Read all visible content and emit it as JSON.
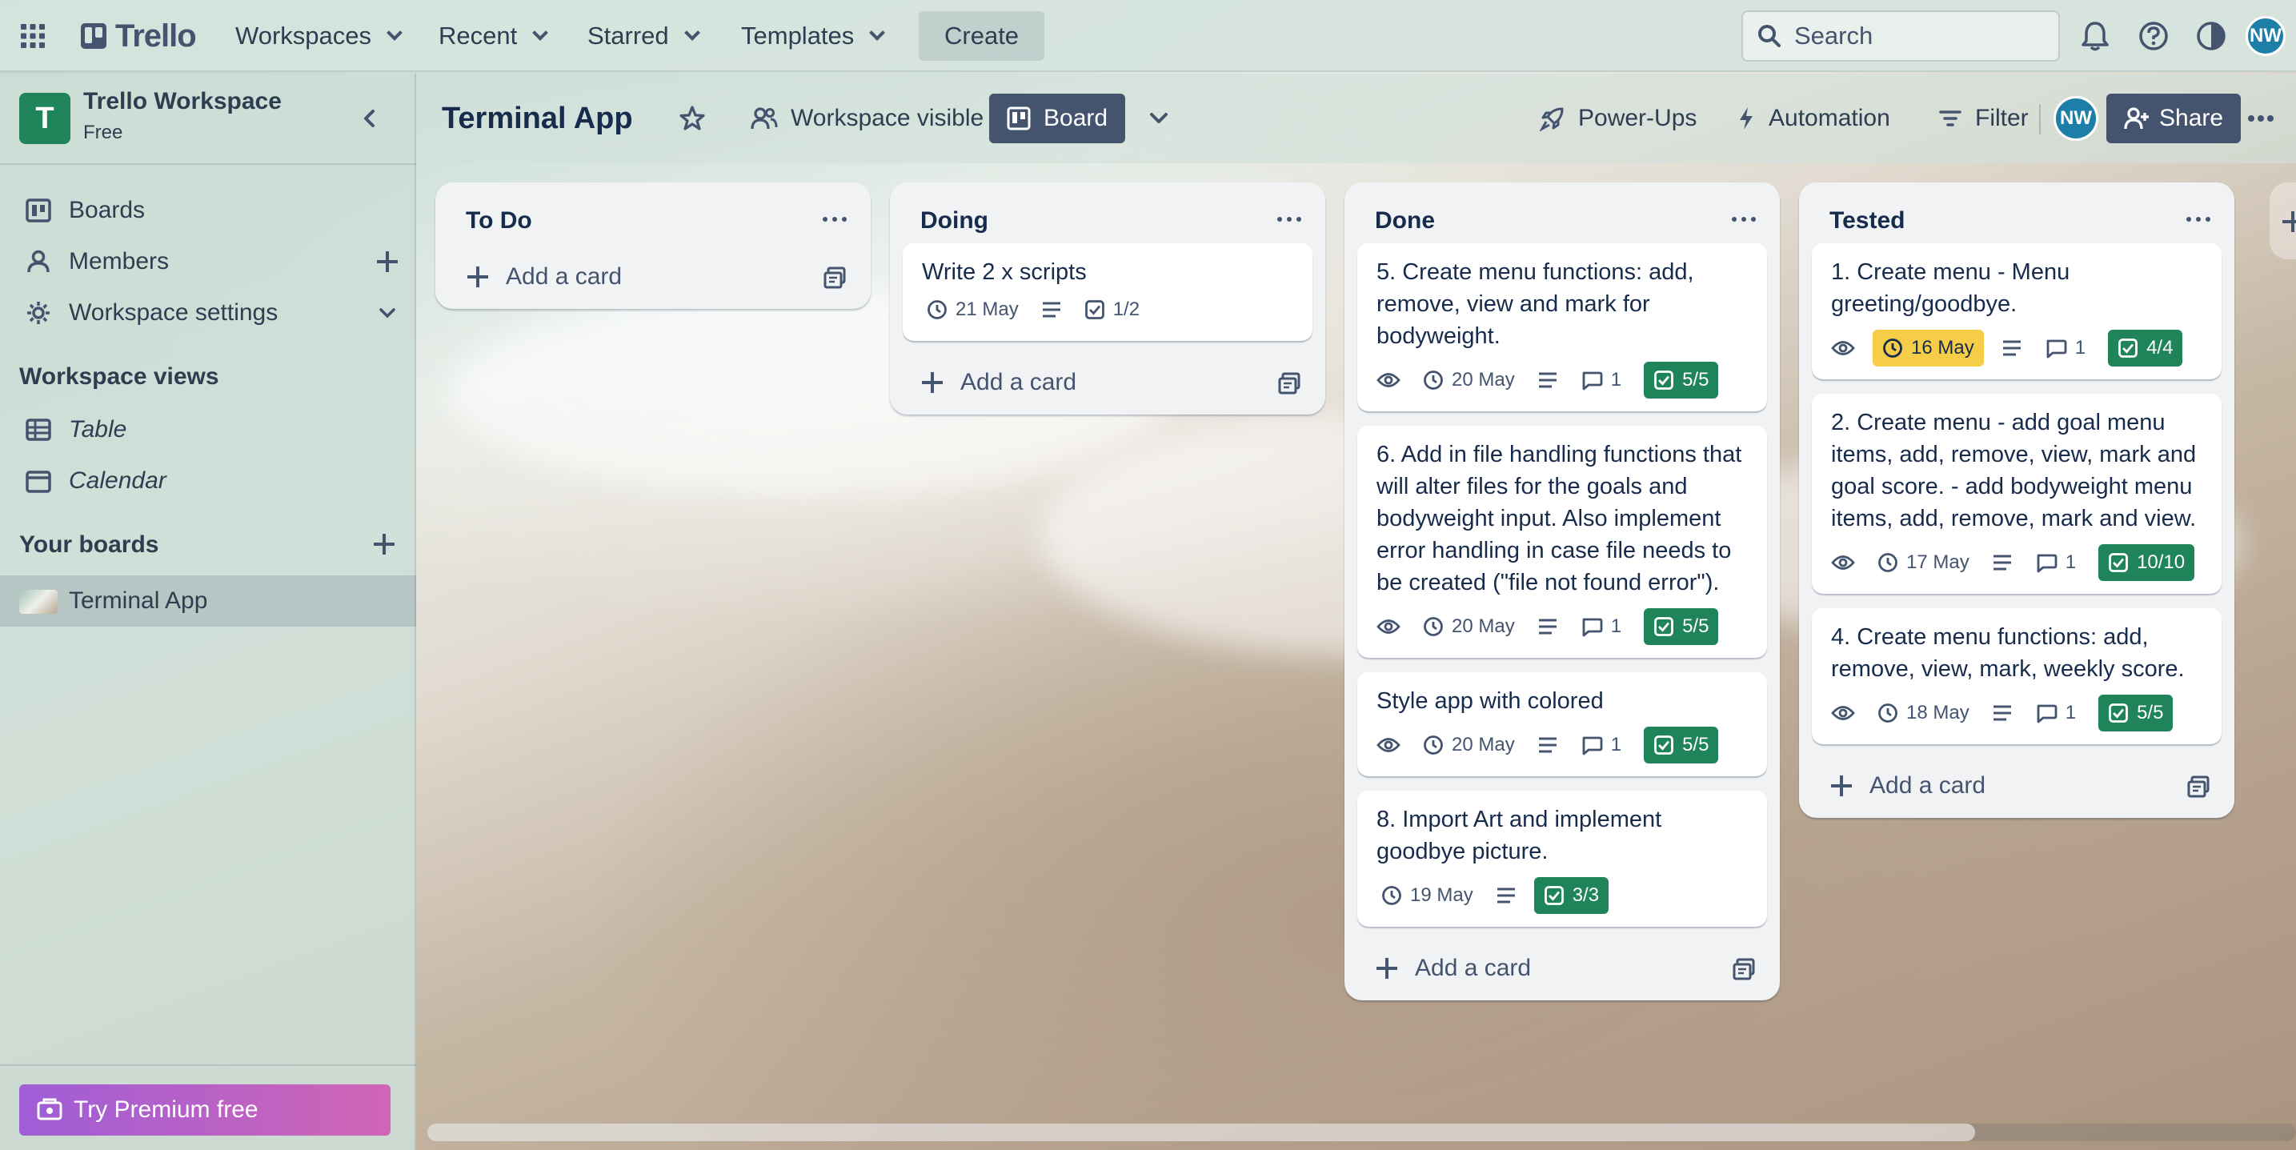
{
  "topbar": {
    "logo_text": "Trello",
    "workspaces": "Workspaces",
    "recent": "Recent",
    "starred": "Starred",
    "templates": "Templates",
    "create": "Create",
    "search_placeholder": "Search",
    "avatar": "NW"
  },
  "sidebar": {
    "workspace_logo": "T",
    "workspace_name": "Trello Workspace",
    "workspace_plan": "Free",
    "items": [
      {
        "label": "Boards"
      },
      {
        "label": "Members"
      },
      {
        "label": "Workspace settings"
      }
    ],
    "views_title": "Workspace views",
    "views": [
      {
        "label": "Table"
      },
      {
        "label": "Calendar"
      }
    ],
    "boards_title": "Your boards",
    "boards": [
      {
        "label": "Terminal App"
      }
    ],
    "premium": "Try Premium free"
  },
  "board": {
    "title": "Terminal App",
    "visibility": "Workspace visible",
    "view": "Board",
    "power_ups": "Power-Ups",
    "automation": "Automation",
    "filter": "Filter",
    "member_avatar": "NW",
    "share": "Share"
  },
  "lists": [
    {
      "title": "To Do",
      "cards": [],
      "add_card": "Add a card"
    },
    {
      "title": "Doing",
      "cards": [
        {
          "title": "Write 2 x scripts",
          "due": "21 May",
          "checklist": "1/2"
        }
      ],
      "add_card": "Add a card"
    },
    {
      "title": "Done",
      "cards": [
        {
          "title": "5. Create menu functions: add, remove, view and mark for bodyweight.",
          "due": "20 May",
          "comments": "1",
          "checklist": "5/5"
        },
        {
          "title": "6. Add in file handling functions that will alter files for the goals and bodyweight input. Also implement error handling in case file needs to be created (\"file not found error\").",
          "due": "20 May",
          "comments": "1",
          "checklist": "5/5"
        },
        {
          "title": "Style app with colored",
          "due": "20 May",
          "comments": "1",
          "checklist": "5/5"
        },
        {
          "title": "8. Import Art and implement goodbye picture.",
          "due": "19 May",
          "checklist": "3/3"
        }
      ],
      "add_card": "Add a card"
    },
    {
      "title": "Tested",
      "cards": [
        {
          "title": "1. Create menu - Menu greeting/goodbye.",
          "due": "16 May",
          "comments": "1",
          "checklist": "4/4"
        },
        {
          "title": "2. Create menu - add goal menu items, add, remove, view, mark and goal score. - add bodyweight menu items, add, remove, mark and view.",
          "due": "17 May",
          "comments": "1",
          "checklist": "10/10"
        },
        {
          "title": "4. Create menu functions: add, remove, view, mark, weekly score.",
          "due": "18 May",
          "comments": "1",
          "checklist": "5/5"
        }
      ],
      "add_card": "Add a card"
    }
  ],
  "colors": {
    "checklist_complete": "#1f845a",
    "due_soon": "#f5cd47",
    "workspace_logo": "#1f845a",
    "premium_gradient_start": "#9f5dd6",
    "premium_gradient_end": "#d065b5"
  }
}
